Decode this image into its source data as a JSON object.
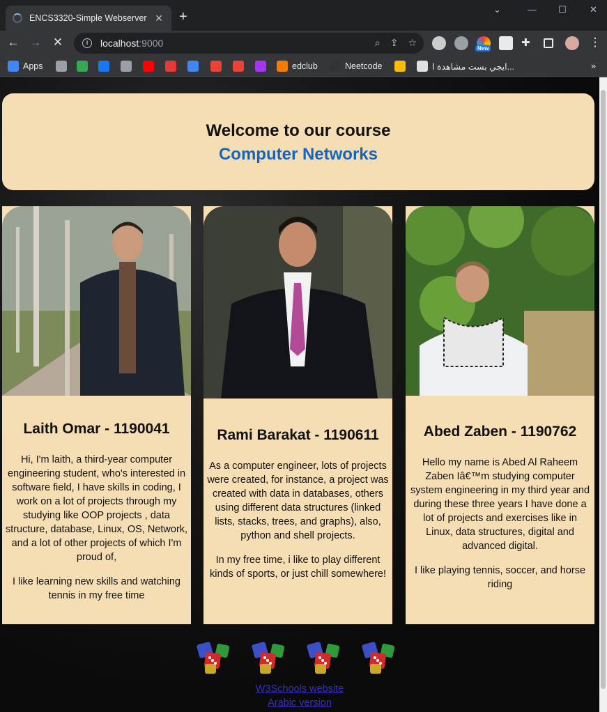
{
  "browser": {
    "tab_title": "ENCS3320-Simple Webserver",
    "url_host": "localhost",
    "url_port": ":9000",
    "new_badge": "New",
    "bookmarks": [
      {
        "label": "Apps",
        "icon": "apps-grid-icon",
        "color": "#4285f4"
      },
      {
        "label": "",
        "icon": "page-icon",
        "color": "#9aa0a6"
      },
      {
        "label": "",
        "icon": "tree-icon",
        "color": "#34a853"
      },
      {
        "label": "",
        "icon": "facebook-icon",
        "color": "#1877f2"
      },
      {
        "label": "",
        "icon": "globe-icon",
        "color": "#9aa0a6"
      },
      {
        "label": "",
        "icon": "youtube-icon",
        "color": "#ff0000"
      },
      {
        "label": "",
        "icon": "rainbow-icon",
        "color": "#e53935"
      },
      {
        "label": "",
        "icon": "translate-icon",
        "color": "#4285f4"
      },
      {
        "label": "",
        "icon": "google-icon",
        "color": "#ea4335"
      },
      {
        "label": "",
        "icon": "gmail-icon",
        "color": "#ea4335"
      },
      {
        "label": "",
        "icon": "udemy-icon",
        "color": "#a435f0"
      },
      {
        "label": "edclub",
        "icon": "edclub-icon",
        "color": "#f57c00"
      },
      {
        "label": "Neetcode",
        "icon": "neetcode-icon",
        "color": "#333333"
      },
      {
        "label": "",
        "icon": "bolt-icon",
        "color": "#fbbc05"
      },
      {
        "label": "ايجي بست مشاهدة ا...",
        "icon": "egybest-icon",
        "color": "#e0e0e0"
      }
    ]
  },
  "page": {
    "welcome_title": "Welcome to our course",
    "course_name": "Computer Networks",
    "members": [
      {
        "name": "Laith Omar - 1190041",
        "paragraphs": [
          "Hi, I'm laith, a third-year computer engineering student, who's interested in software field, I have skills in coding, I work on a lot of projects through my studying like OOP projects , data structure, database, Linux, OS, Network, and a lot of other projects of which I'm proud of,",
          "I like learning new skills and watching tennis in my free time"
        ]
      },
      {
        "name": "Rami Barakat - 1190611",
        "paragraphs": [
          "As a computer engineer, lots of projects were created, for instance, a project was created with data in databases, others using different data structures (linked lists, stacks, trees, and graphs), also, python and shell projects.",
          "In my free time, i like to play different kinds of sports, or just chill somewhere!"
        ]
      },
      {
        "name": "Abed Zaben - 1190762",
        "paragraphs": [
          "Hello my name is Abed Al Raheem Zaben Iâ€™m studying computer system engineering in my third year and during these three years I have done a lot of projects and exercises like in Linux, data structures, digital and advanced digital.",
          "I like playing tennis, soccer, and horse riding"
        ]
      }
    ],
    "links": {
      "w3schools": "W3Schools website",
      "arabic": "Arabic version"
    }
  },
  "colors": {
    "card_bg": "#f5deb3",
    "course_name": "#1565c0",
    "link": "#3b2fbf"
  }
}
